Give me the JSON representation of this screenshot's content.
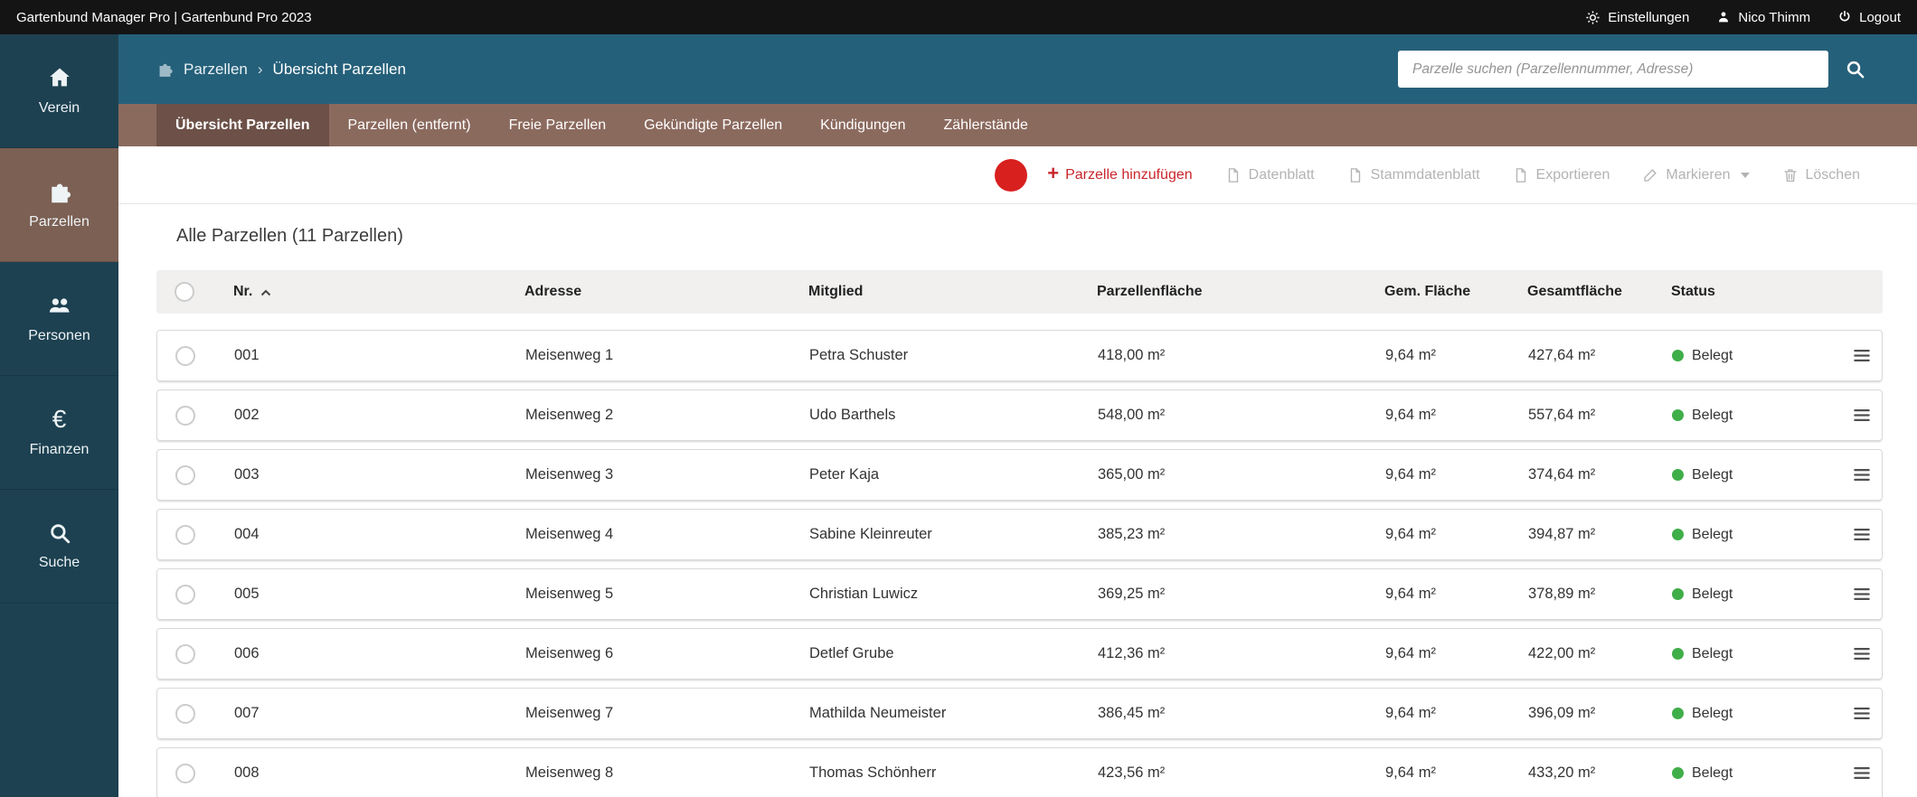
{
  "topbar": {
    "title": "Gartenbund Manager Pro | Gartenbund Pro 2023",
    "settings_label": "Einstellungen",
    "user_name": "Nico Thimm",
    "logout_label": "Logout"
  },
  "sidebar": {
    "items": [
      {
        "label": "Verein",
        "icon": "home-icon",
        "active": false
      },
      {
        "label": "Parzellen",
        "icon": "puzzle-icon",
        "active": true
      },
      {
        "label": "Personen",
        "icon": "people-icon",
        "active": false
      },
      {
        "label": "Finanzen",
        "icon": "euro-icon",
        "active": false
      },
      {
        "label": "Suche",
        "icon": "search-icon",
        "active": false
      }
    ]
  },
  "header": {
    "breadcrumb_parent": "Parzellen",
    "breadcrumb_separator": "›",
    "breadcrumb_current": "Übersicht Parzellen",
    "search_placeholder": "Parzelle suchen (Parzellennummer, Adresse)"
  },
  "tabs": [
    {
      "label": "Übersicht Parzellen",
      "active": true
    },
    {
      "label": "Parzellen (entfernt)",
      "active": false
    },
    {
      "label": "Freie Parzellen",
      "active": false
    },
    {
      "label": "Gekündigte Parzellen",
      "active": false
    },
    {
      "label": "Kündigungen",
      "active": false
    },
    {
      "label": "Zählerstände",
      "active": false
    }
  ],
  "toolbar": {
    "add_plus": "+",
    "add_label": "Parzelle hinzufügen",
    "items": [
      {
        "label": "Datenblatt",
        "icon": "document-icon"
      },
      {
        "label": "Stammdatenblatt",
        "icon": "document-icon"
      },
      {
        "label": "Exportieren",
        "icon": "document-icon"
      },
      {
        "label": "Markieren",
        "icon": "pencil-icon",
        "has_caret": true
      },
      {
        "label": "Löschen",
        "icon": "trash-icon"
      }
    ]
  },
  "content": {
    "title": "Alle Parzellen (11 Parzellen)"
  },
  "table": {
    "headers": {
      "nr": "Nr.",
      "adresse": "Adresse",
      "mitglied": "Mitglied",
      "parzellenflaeche": "Parzellenfläche",
      "gem_flaeche": "Gem. Fläche",
      "gesamtflaeche": "Gesamtfläche",
      "status": "Status"
    },
    "rows": [
      {
        "nr": "001",
        "adresse": "Meisenweg 1",
        "mitglied": "Petra Schuster",
        "parzellenflaeche": "418,00 m²",
        "gem_flaeche": "9,64 m²",
        "gesamtflaeche": "427,64 m²",
        "status": "Belegt"
      },
      {
        "nr": "002",
        "adresse": "Meisenweg 2",
        "mitglied": "Udo Barthels",
        "parzellenflaeche": "548,00 m²",
        "gem_flaeche": "9,64 m²",
        "gesamtflaeche": "557,64 m²",
        "status": "Belegt"
      },
      {
        "nr": "003",
        "adresse": "Meisenweg 3",
        "mitglied": "Peter Kaja",
        "parzellenflaeche": "365,00 m²",
        "gem_flaeche": "9,64 m²",
        "gesamtflaeche": "374,64 m²",
        "status": "Belegt"
      },
      {
        "nr": "004",
        "adresse": "Meisenweg 4",
        "mitglied": "Sabine Kleinreuter",
        "parzellenflaeche": "385,23 m²",
        "gem_flaeche": "9,64 m²",
        "gesamtflaeche": "394,87 m²",
        "status": "Belegt"
      },
      {
        "nr": "005",
        "adresse": "Meisenweg 5",
        "mitglied": "Christian Luwicz",
        "parzellenflaeche": "369,25 m²",
        "gem_flaeche": "9,64 m²",
        "gesamtflaeche": "378,89 m²",
        "status": "Belegt"
      },
      {
        "nr": "006",
        "adresse": "Meisenweg 6",
        "mitglied": "Detlef Grube",
        "parzellenflaeche": "412,36 m²",
        "gem_flaeche": "9,64 m²",
        "gesamtflaeche": "422,00 m²",
        "status": "Belegt"
      },
      {
        "nr": "007",
        "adresse": "Meisenweg 7",
        "mitglied": "Mathilda Neumeister",
        "parzellenflaeche": "386,45 m²",
        "gem_flaeche": "9,64 m²",
        "gesamtflaeche": "396,09 m²",
        "status": "Belegt"
      },
      {
        "nr": "008",
        "adresse": "Meisenweg 8",
        "mitglied": "Thomas Schönherr",
        "parzellenflaeche": "423,56 m²",
        "gem_flaeche": "9,64 m²",
        "gesamtflaeche": "433,20 m²",
        "status": "Belegt"
      }
    ]
  },
  "colors": {
    "topbar_bg": "#141414",
    "sidebar_bg": "#1d4151",
    "sidebar_active_bg": "#7c6054",
    "header_teal": "#25607a",
    "tabbar_bg": "#8b6a5e",
    "tab_active_bg": "#6d5148",
    "accent_red": "#d8201f",
    "status_green": "#3fae49",
    "disabled_gray": "#b3b3b3"
  }
}
